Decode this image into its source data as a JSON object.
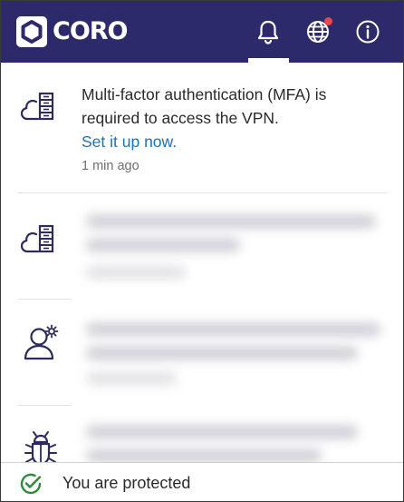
{
  "app": {
    "logo_text": "CORO"
  },
  "nav": {
    "notifications_icon": "bell-icon",
    "network_icon": "globe-icon",
    "info_icon": "info-icon",
    "accent": "#2c2a6a",
    "badge_color": "#e5484d"
  },
  "notifications": [
    {
      "icon": "cloud-server-icon",
      "message": "Multi-factor authentication (MFA) is required to access the VPN.",
      "link": "Set it up now.",
      "time": "1 min ago"
    },
    {
      "icon": "cloud-server-icon",
      "message": "",
      "time": ""
    },
    {
      "icon": "user-settings-icon",
      "message": "",
      "time": ""
    },
    {
      "icon": "bug-icon",
      "message": "",
      "time": ""
    }
  ],
  "footer": {
    "status_icon": "check-circle-icon",
    "status_text": "You are protected",
    "status_color": "#2e8b3a"
  }
}
